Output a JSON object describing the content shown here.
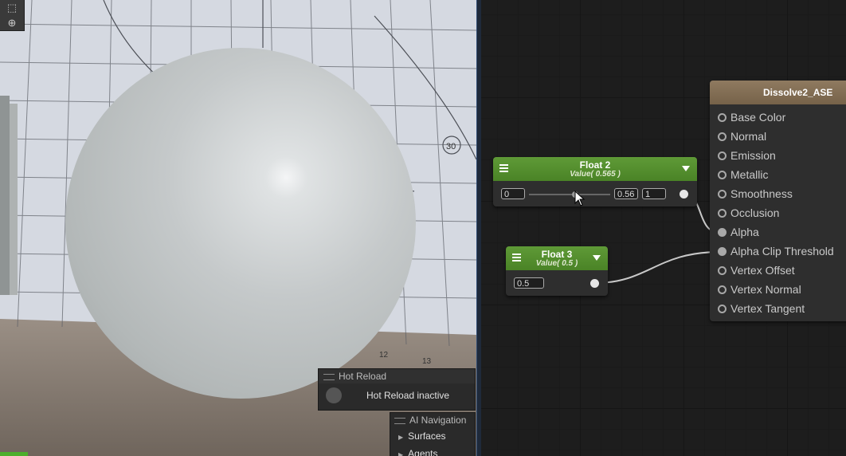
{
  "scene_view": {
    "toolbar": {
      "rect_tool_icon": "rect-select-icon",
      "grid_tool_icon": "grid-snap-icon"
    },
    "overlay_numbers": [
      "30",
      "12",
      "13"
    ],
    "hot_reload": {
      "header": "Hot Reload",
      "status": "Hot Reload inactive"
    },
    "ai_navigation": {
      "header": "AI Navigation",
      "items": [
        "Surfaces",
        "Agents"
      ]
    }
  },
  "graph": {
    "float2": {
      "title": "Float 2",
      "subtitle": "Value( 0.565 )",
      "min": "0",
      "value": "0.56",
      "max": "1",
      "slider_fraction": 0.565
    },
    "float3": {
      "title": "Float 3",
      "subtitle": "Value( 0.5 )",
      "value": "0.5"
    },
    "master": {
      "title": "Dissolve2_ASE",
      "ports": [
        "Base Color",
        "Normal",
        "Emission",
        "Metallic",
        "Smoothness",
        "Occlusion",
        "Alpha",
        "Alpha Clip Threshold",
        "Vertex Offset",
        "Vertex Normal",
        "Vertex Tangent"
      ]
    },
    "colors": {
      "node_header": "#5f9a37",
      "master_header": "#8f7a60",
      "wire": "#c8c8c8"
    }
  }
}
